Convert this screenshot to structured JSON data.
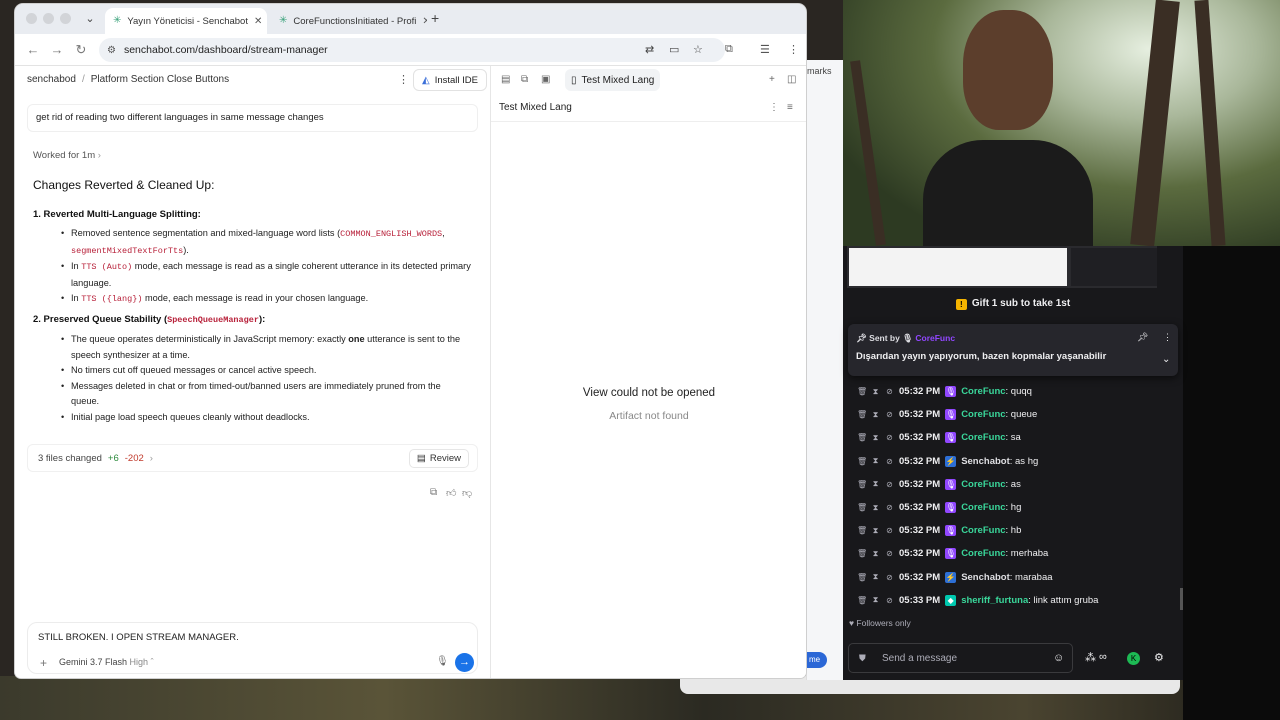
{
  "browser": {
    "tabs": [
      {
        "label": "Yayın Yöneticisi - Senchabot",
        "active": true
      },
      {
        "label": "CoreFunctionsInitiated - Profi",
        "active": false
      }
    ],
    "url": "senchabot.com/dashboard/stream-manager"
  },
  "chat_pane": {
    "breadcrumb": [
      "senchabod",
      "Platform Section Close Buttons"
    ],
    "install_ide": "Install IDE",
    "user_prompt": "get rid of reading two different languages in same message changes",
    "worked_for": "Worked for 1m",
    "changes_title": "Changes Reverted & Cleaned Up:",
    "section1": {
      "heading": "1. Reverted Multi-Language Splitting:",
      "bullets": [
        {
          "pre": "Removed sentence segmentation and mixed-language word lists (",
          "code1": "COMMON_ENGLISH_WORDS",
          "mid": ", ",
          "code2": "segmentMixedTextForTts",
          "post": ")."
        },
        {
          "pre": "In ",
          "code1": "TTS (Auto)",
          "post": " mode, each message is read as a single coherent utterance in its detected primary language."
        },
        {
          "pre": "In ",
          "code1": "TTS ({lang})",
          "post": " mode, each message is read in your chosen language."
        }
      ]
    },
    "section2": {
      "heading_pre": "2. Preserved Queue Stability (",
      "heading_code": "SpeechQueueManager",
      "heading_post": "):",
      "bullets": [
        {
          "pre": "The queue operates deterministically in JavaScript memory: exactly ",
          "bold": "one",
          "post": " utterance is sent to the speech synthesizer at a time."
        },
        {
          "text": "No timers cut off queued messages or cancel active speech."
        },
        {
          "text": "Messages deleted in chat or from timed-out/banned users are immediately pruned from the queue."
        },
        {
          "text": "Initial page load speech queues cleanly without deadlocks."
        }
      ]
    },
    "files_changed": {
      "label": "3 files changed",
      "added": "+6",
      "removed": "-202",
      "review": "Review"
    },
    "composer": {
      "input": "STILL BROKEN. I OPEN STREAM MANAGER.",
      "model": "Gemini 3.7 Flash",
      "effort": "High"
    }
  },
  "artifact_pane": {
    "tab_label": "Test Mixed Lang",
    "title": "Test Mixed Lang",
    "empty_title": "View could not be opened",
    "empty_subtitle": "Artifact not found"
  },
  "behind_window": {
    "marks": "marks",
    "button": "me"
  },
  "stream_chat": {
    "gift_banner": "Gift 1 sub to take 1st",
    "pinned": {
      "sent_by_label": "Sent by",
      "sent_by_user": "CoreFunc",
      "message": "Dışarıdan yayın yapıyorum, bazen kopmalar yaşanabilir"
    },
    "messages": [
      {
        "time": "05:32 PM",
        "user": "CoreFunc",
        "text": ": quqq",
        "color": "#3ad69a",
        "badge": "mic"
      },
      {
        "time": "05:32 PM",
        "user": "CoreFunc",
        "text": ": queue",
        "color": "#3ad69a",
        "badge": "mic"
      },
      {
        "time": "05:32 PM",
        "user": "CoreFunc",
        "text": ": sa",
        "color": "#3ad69a",
        "badge": "mic"
      },
      {
        "time": "05:32 PM",
        "user": "Senchabot",
        "text": ": as hg",
        "color": "#dfdfe3",
        "badge": "bot"
      },
      {
        "time": "05:32 PM",
        "user": "CoreFunc",
        "text": ": as",
        "color": "#3ad69a",
        "badge": "mic"
      },
      {
        "time": "05:32 PM",
        "user": "CoreFunc",
        "text": ": hg",
        "color": "#3ad69a",
        "badge": "mic"
      },
      {
        "time": "05:32 PM",
        "user": "CoreFunc",
        "text": ": hb",
        "color": "#3ad69a",
        "badge": "mic"
      },
      {
        "time": "05:32 PM",
        "user": "CoreFunc",
        "text": ": merhaba",
        "color": "#3ad69a",
        "badge": "mic"
      },
      {
        "time": "05:32 PM",
        "user": "Senchabot",
        "text": ": marabaa",
        "color": "#dfdfe3",
        "badge": "bot"
      },
      {
        "time": "05:33 PM",
        "user": "sheriff_furtuna",
        "text": ": link attım gruba",
        "color": "#3ad69a",
        "badge": "game"
      }
    ],
    "followers_only": "Followers only",
    "send_placeholder": "Send a message"
  },
  "colors": {
    "accent": "#1a73e8",
    "twitch_purple": "#9147ff",
    "chat_bg": "#18181b"
  }
}
